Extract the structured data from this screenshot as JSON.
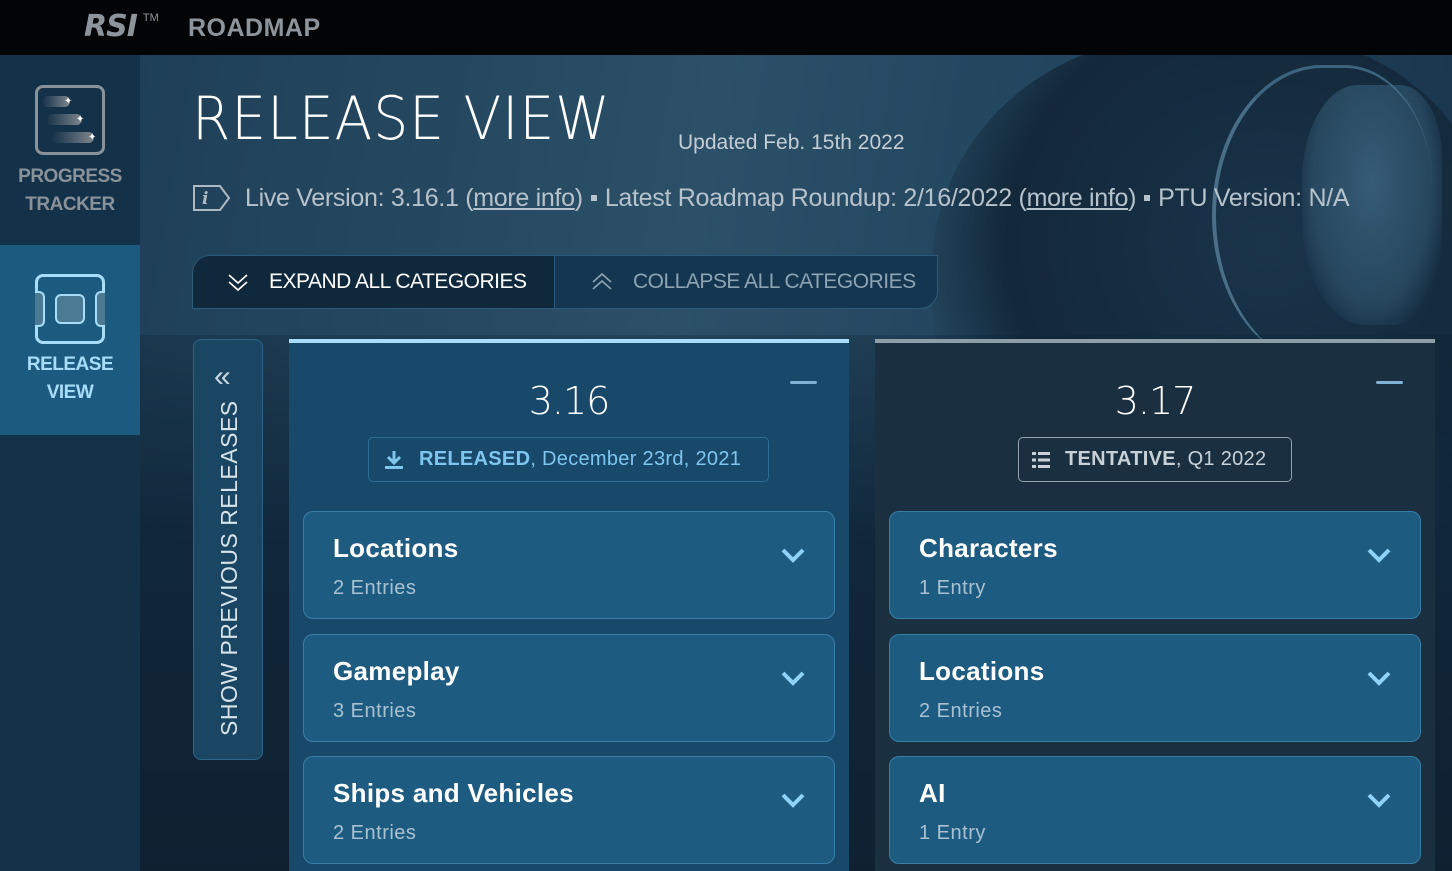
{
  "topbar": {
    "logo": "RSI",
    "trademark": "TM",
    "app_name": "ROADMAP"
  },
  "sidebar": {
    "items": [
      {
        "id": "progress-tracker",
        "line1": "PROGRESS",
        "line2": "TRACKER",
        "icon": "progress-tracker-icon",
        "active": false
      },
      {
        "id": "release-view",
        "line1": "RELEASE",
        "line2": "VIEW",
        "icon": "release-view-icon",
        "active": true
      }
    ]
  },
  "header": {
    "title": "RELEASE VIEW",
    "updated": "Updated Feb. 15th 2022"
  },
  "info": {
    "live_label": "Live Version: 3.16.1 (",
    "live_link": "more info",
    "live_close": ")",
    "roundup_label": "Latest Roadmap Roundup: 2/16/2022 (",
    "roundup_link": "more info",
    "roundup_close": ")",
    "ptu_label": "PTU Version: N/A"
  },
  "toggle": {
    "expand_label": "EXPAND ALL CATEGORIES",
    "collapse_label": "COLLAPSE ALL CATEGORIES",
    "active": "expand"
  },
  "previous_releases": {
    "label": "SHOW PREVIOUS RELEASES",
    "chevron": "«"
  },
  "colors": {
    "accent_released": "#a7ddfa",
    "accent_tentative": "#8e9ea6",
    "card_bg": "#1d5b80"
  },
  "releases": [
    {
      "version": "3.16",
      "status": "RELEASED",
      "date": ", December 23rd, 2021",
      "status_icon": "download-icon",
      "categories": [
        {
          "title": "Locations",
          "count": "2 Entries"
        },
        {
          "title": "Gameplay",
          "count": "3 Entries"
        },
        {
          "title": "Ships and Vehicles",
          "count": "2 Entries"
        }
      ]
    },
    {
      "version": "3.17",
      "status": "TENTATIVE",
      "date": ", Q1 2022",
      "status_icon": "list-icon",
      "categories": [
        {
          "title": "Characters",
          "count": "1 Entry"
        },
        {
          "title": "Locations",
          "count": "2 Entries"
        },
        {
          "title": "AI",
          "count": "1 Entry"
        }
      ]
    }
  ]
}
